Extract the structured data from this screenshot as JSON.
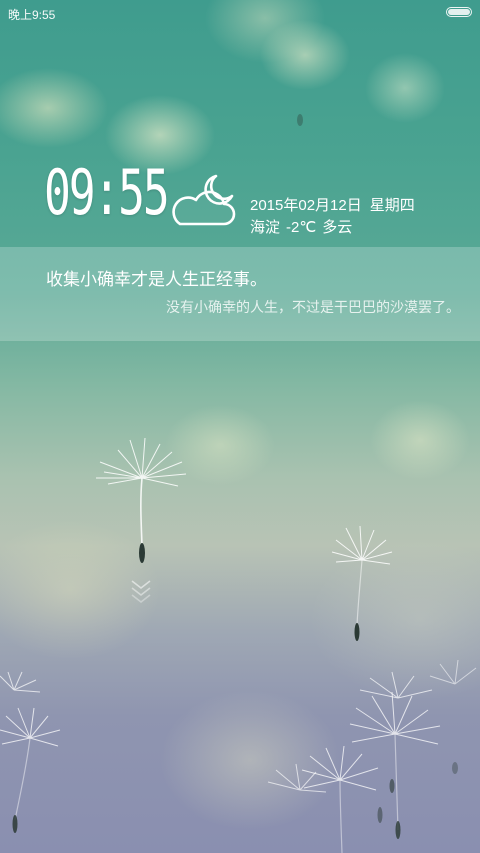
{
  "status_bar": {
    "time": "晚上9:55"
  },
  "lockscreen": {
    "clock": "09:55",
    "date": "2015年02月12日",
    "weekday": "星期四",
    "location": "海淀",
    "temperature": "-2℃",
    "condition": "多云"
  },
  "quote": {
    "main": "收集小确幸才是人生正经事。",
    "sub": "没有小确幸的人生，不过是干巴巴的沙漠罢了。"
  },
  "icons": {
    "weather": "moon-cloud-icon",
    "battery": "battery-icon",
    "unlock": "chevron-down-icon"
  },
  "colors": {
    "text": "#ffffff",
    "panel": "rgba(255,255,255,0.22)"
  }
}
